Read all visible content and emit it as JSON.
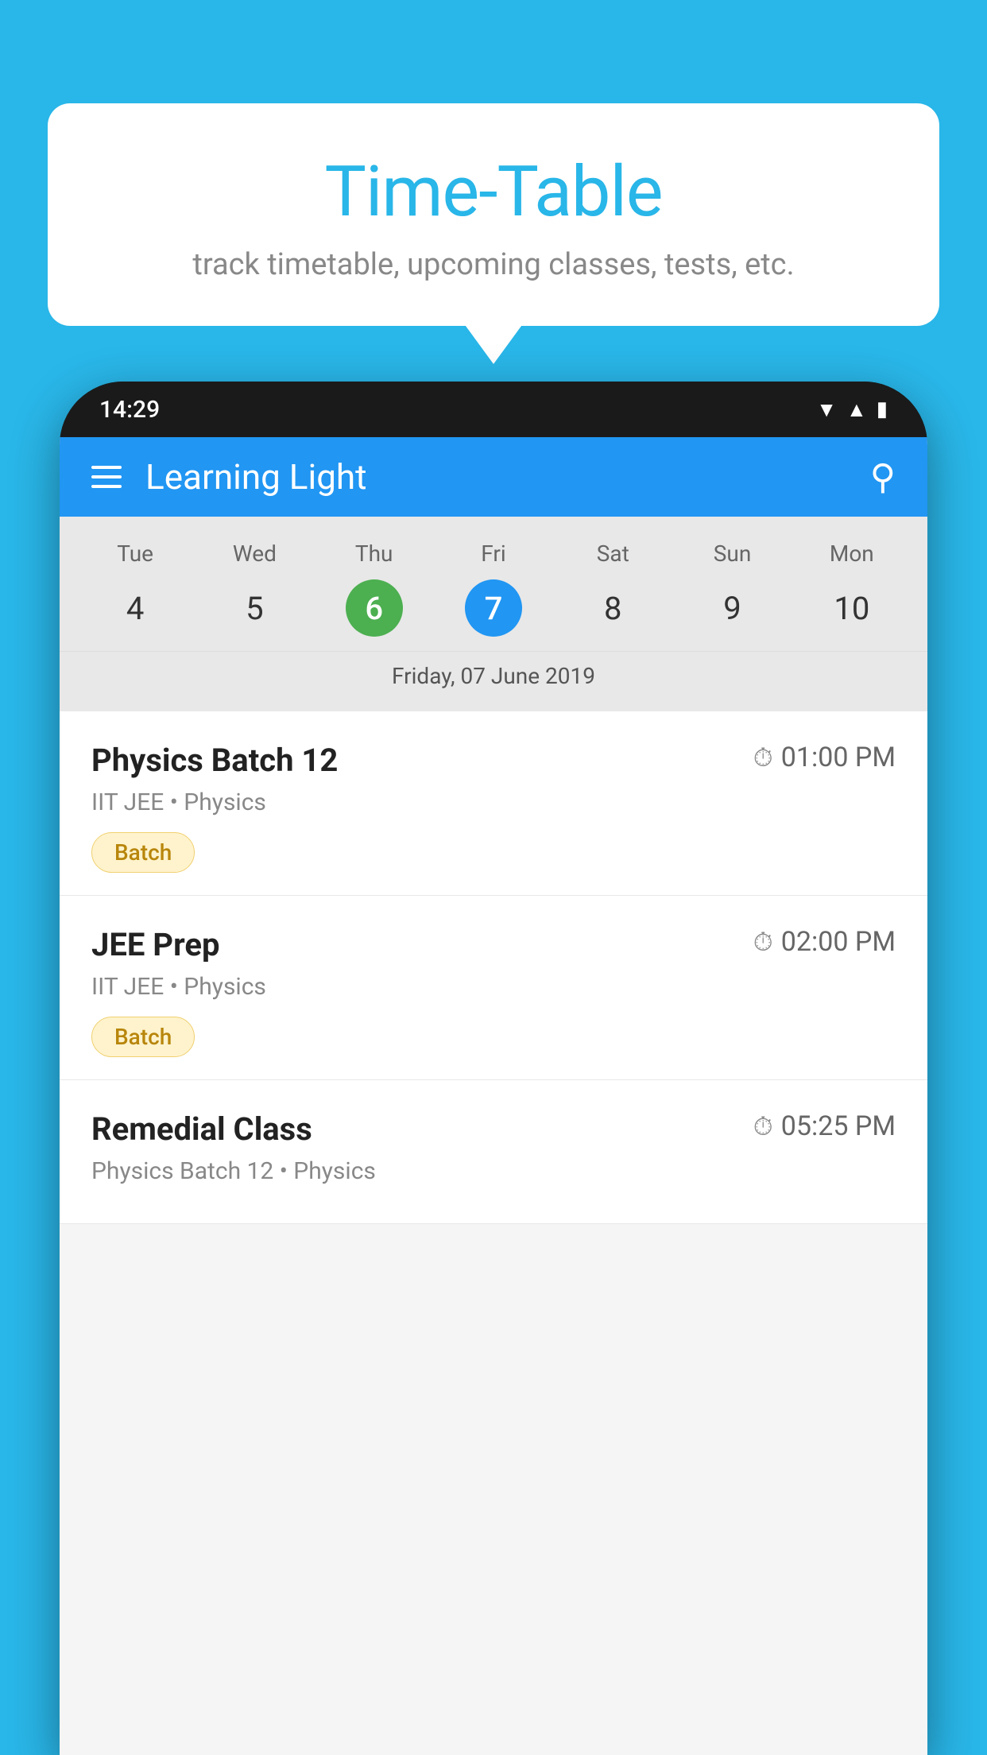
{
  "background": {
    "color": "#29B6E8"
  },
  "speech_bubble": {
    "title": "Time-Table",
    "subtitle": "track timetable, upcoming classes, tests, etc."
  },
  "phone": {
    "status_bar": {
      "time": "14:29"
    },
    "app_header": {
      "title": "Learning Light"
    },
    "calendar": {
      "days": [
        {
          "label": "Tue",
          "num": "4",
          "state": "normal"
        },
        {
          "label": "Wed",
          "num": "5",
          "state": "normal"
        },
        {
          "label": "Thu",
          "num": "6",
          "state": "today"
        },
        {
          "label": "Fri",
          "num": "7",
          "state": "selected"
        },
        {
          "label": "Sat",
          "num": "8",
          "state": "normal"
        },
        {
          "label": "Sun",
          "num": "9",
          "state": "normal"
        },
        {
          "label": "Mon",
          "num": "10",
          "state": "normal"
        }
      ],
      "selected_date_label": "Friday, 07 June 2019"
    },
    "schedule": [
      {
        "title": "Physics Batch 12",
        "time": "01:00 PM",
        "subtitle": "IIT JEE • Physics",
        "badge": "Batch"
      },
      {
        "title": "JEE Prep",
        "time": "02:00 PM",
        "subtitle": "IIT JEE • Physics",
        "badge": "Batch"
      },
      {
        "title": "Remedial Class",
        "time": "05:25 PM",
        "subtitle": "Physics Batch 12 • Physics",
        "badge": null
      }
    ]
  }
}
